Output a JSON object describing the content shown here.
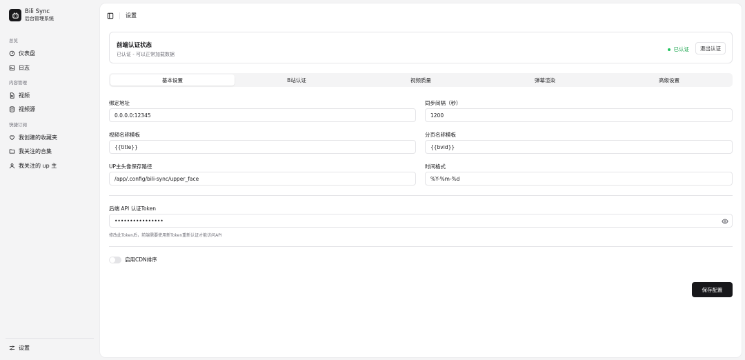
{
  "brand": {
    "name": "Bili Sync",
    "subtitle": "后台管理系统"
  },
  "sidebar": {
    "groups": [
      {
        "label": "总览",
        "items": [
          {
            "label": "仪表盘",
            "icon": "gauge-icon"
          },
          {
            "label": "日志",
            "icon": "terminal-icon"
          }
        ]
      },
      {
        "label": "内容管理",
        "items": [
          {
            "label": "视频",
            "icon": "file-video-icon"
          },
          {
            "label": "视频源",
            "icon": "database-icon"
          }
        ]
      },
      {
        "label": "快捷订阅",
        "items": [
          {
            "label": "我创建的收藏夹",
            "icon": "heart-icon"
          },
          {
            "label": "我关注的合集",
            "icon": "folder-icon"
          },
          {
            "label": "我关注的 up 主",
            "icon": "user-icon"
          }
        ]
      }
    ],
    "footer": {
      "label": "设置",
      "icon": "sliders-icon"
    }
  },
  "header": {
    "breadcrumb": "设置",
    "icon": "sidebar-toggle-icon"
  },
  "auth": {
    "title": "前端认证状态",
    "description": "已认证 - 可以正常加载数据",
    "status": "已认证",
    "logout_label": "退出认证",
    "status_color": "#22c55e"
  },
  "tabs": [
    {
      "label": "基本设置",
      "active": true
    },
    {
      "label": "B站认证",
      "active": false
    },
    {
      "label": "视频质量",
      "active": false
    },
    {
      "label": "弹幕渲染",
      "active": false
    },
    {
      "label": "高级设置",
      "active": false
    }
  ],
  "form": {
    "bind_address": {
      "label": "绑定地址",
      "value": "0.0.0.0:12345"
    },
    "sync_interval": {
      "label": "同步间隔（秒）",
      "value": "1200"
    },
    "video_name_template": {
      "label": "视频名称模板",
      "value": "{{title}}"
    },
    "page_name_template": {
      "label": "分页名称模板",
      "value": "{{bvid}}"
    },
    "upper_face_path": {
      "label": "UP主头像保存路径",
      "value": "/app/.config/bili-sync/upper_face"
    },
    "time_format": {
      "label": "时间格式",
      "value": "%Y-%m-%d"
    },
    "auth_token": {
      "label": "后端 API 认证Token",
      "value": "••••••••••••••••",
      "icon": "eye-icon"
    },
    "token_hint": "修改此Token后，前端需要使用新Token重新认证才能访问API",
    "cdn_sort": {
      "label": "启用CDN排序",
      "enabled": false
    }
  },
  "save_label": "保存配置"
}
